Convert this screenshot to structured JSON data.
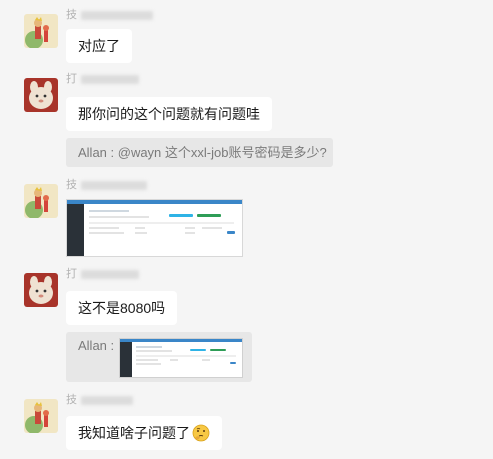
{
  "messages": [
    {
      "type": "text",
      "sender_visible": "技",
      "text": "对应了",
      "avatar": "little-prince-avatar-icon"
    },
    {
      "type": "text",
      "sender_visible": "打",
      "text": "那你问的这个问题就有问题哇",
      "avatar": "cartoon-animal-avatar-icon"
    },
    {
      "type": "quote",
      "text": "Allan : @wayn 这个xxl-job账号密码是多少?"
    },
    {
      "type": "image",
      "sender_visible": "技",
      "avatar": "little-prince-avatar-icon"
    },
    {
      "type": "text",
      "sender_visible": "打",
      "text": "这不是8080吗",
      "avatar": "cartoon-animal-avatar-icon"
    },
    {
      "type": "quote-image",
      "text": "Allan :"
    },
    {
      "type": "text",
      "sender_visible": "技",
      "text": "我知道啥子问题了",
      "emoji": "thinking-face-icon",
      "avatar": "little-prince-avatar-icon"
    }
  ],
  "colors": {
    "background": "#f5f5f5",
    "bubble": "#ffffff",
    "quote": "#e7e7e7",
    "shot_header": "#3a86c8",
    "shot_sidebar": "#2a3138"
  }
}
